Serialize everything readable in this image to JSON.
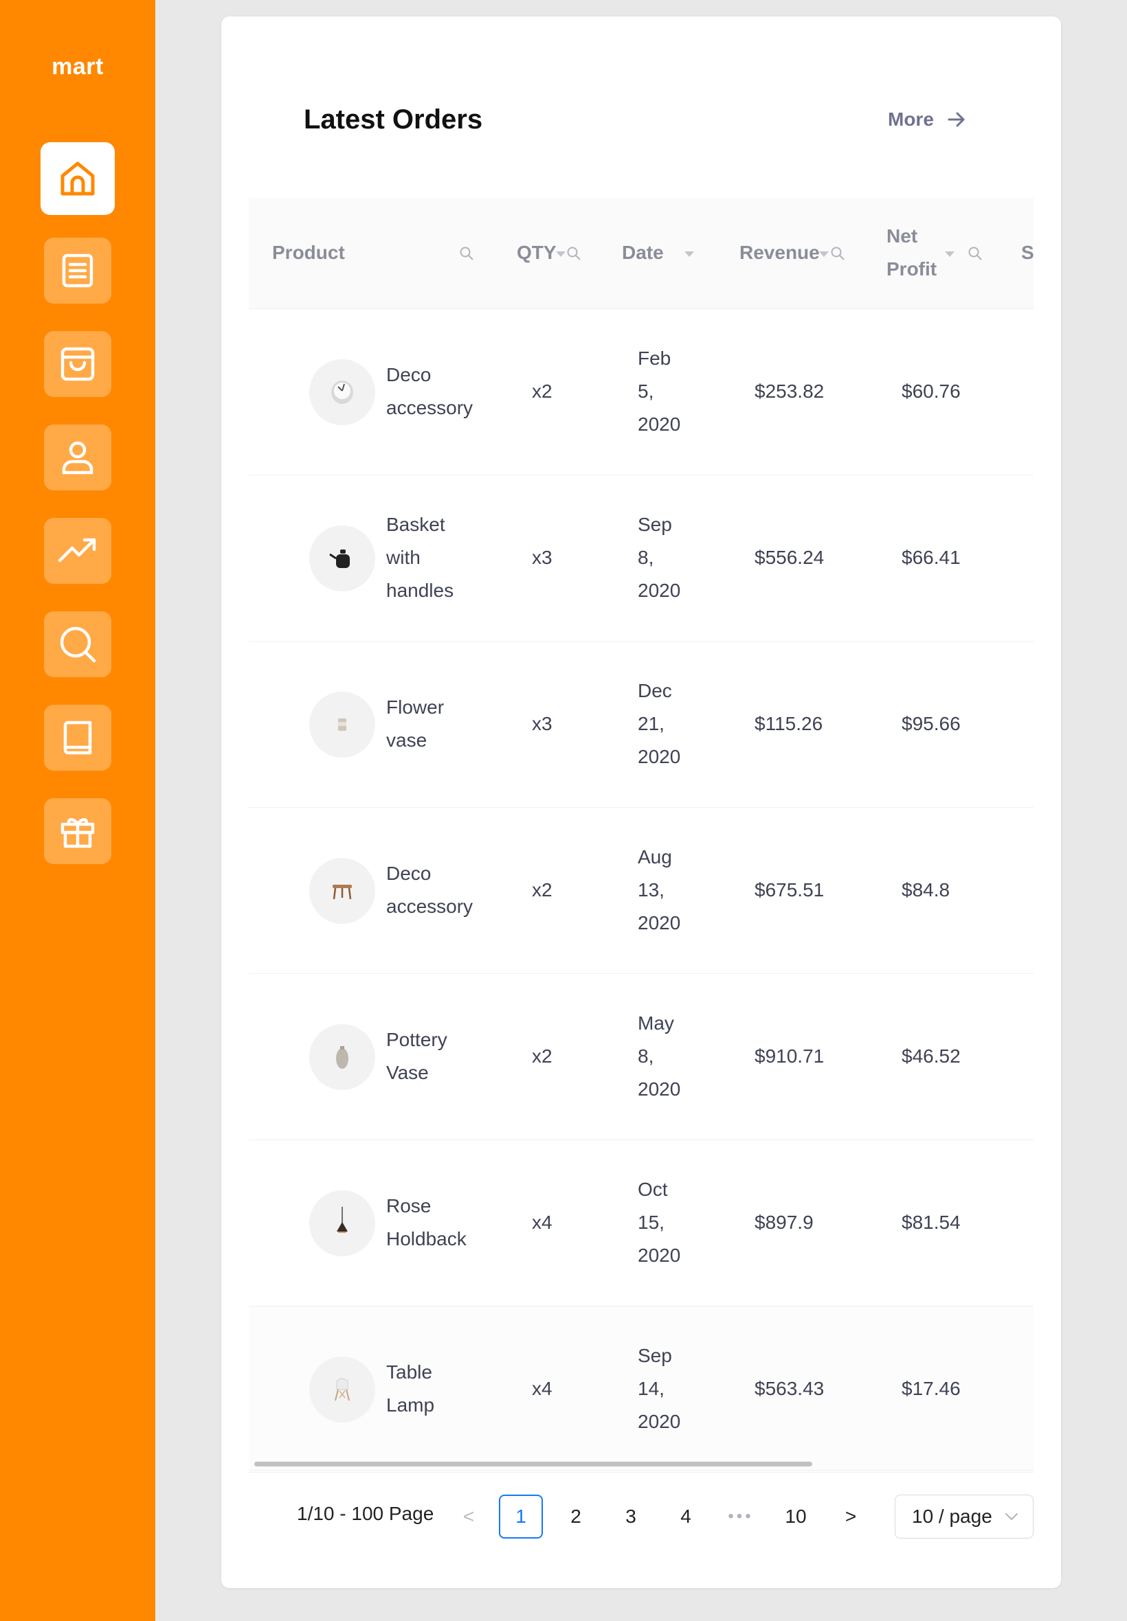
{
  "app": {
    "brand": "mart"
  },
  "sidebar": {
    "items": [
      {
        "icon": "home-icon",
        "active": true
      },
      {
        "icon": "document-icon",
        "active": false
      },
      {
        "icon": "shopping-bag-icon",
        "active": false
      },
      {
        "icon": "user-icon",
        "active": false
      },
      {
        "icon": "trending-up-icon",
        "active": false
      },
      {
        "icon": "search-icon",
        "active": false
      },
      {
        "icon": "book-icon",
        "active": false
      },
      {
        "icon": "gift-icon",
        "active": false
      }
    ]
  },
  "card": {
    "title": "Latest Orders",
    "more_label": "More"
  },
  "table": {
    "columns": {
      "product": "Product",
      "qty": "QTY",
      "date": "Date",
      "revenue": "Revenue",
      "net_profit_1": "Net",
      "net_profit_2": "Profit",
      "status_partial": "S"
    },
    "rows": [
      {
        "product_lines": [
          "Deco",
          "accessory"
        ],
        "thumb": "clock-icon",
        "qty": "x2",
        "date_lines": [
          "Feb",
          "5,",
          "2020"
        ],
        "revenue": "$253.82",
        "net": "$60.76"
      },
      {
        "product_lines": [
          "Basket",
          "with",
          "handles"
        ],
        "thumb": "kettle-icon",
        "qty": "x3",
        "date_lines": [
          "Sep",
          "8,",
          "2020"
        ],
        "revenue": "$556.24",
        "net": "$66.41"
      },
      {
        "product_lines": [
          "Flower",
          "vase"
        ],
        "thumb": "cup-icon",
        "qty": "x3",
        "date_lines": [
          "Dec",
          "21,",
          "2020"
        ],
        "revenue": "$115.26",
        "net": "$95.66"
      },
      {
        "product_lines": [
          "Deco",
          "accessory"
        ],
        "thumb": "stool-icon",
        "qty": "x2",
        "date_lines": [
          "Aug",
          "13,",
          "2020"
        ],
        "revenue": "$675.51",
        "net": "$84.8"
      },
      {
        "product_lines": [
          "Pottery",
          "Vase"
        ],
        "thumb": "vase-icon",
        "qty": "x2",
        "date_lines": [
          "May",
          "8,",
          "2020"
        ],
        "revenue": "$910.71",
        "net": "$46.52"
      },
      {
        "product_lines": [
          "Rose",
          "Holdback"
        ],
        "thumb": "pendant-lamp-icon",
        "qty": "x4",
        "date_lines": [
          "Oct",
          "15,",
          "2020"
        ],
        "revenue": "$897.9",
        "net": "$81.54"
      },
      {
        "product_lines": [
          "Table",
          "Lamp"
        ],
        "thumb": "chair-icon",
        "qty": "x4",
        "date_lines": [
          "Sep",
          "14,",
          "2020"
        ],
        "revenue": "$563.43",
        "net": "$17.46"
      }
    ]
  },
  "pagination": {
    "info": "1/10 - 100 Page",
    "prev": "<",
    "pages": [
      "1",
      "2",
      "3",
      "4"
    ],
    "dots": "•••",
    "last": "10",
    "next": ">",
    "current": "1",
    "page_size": "10 / page"
  },
  "colors": {
    "sidebar": "#ff8800",
    "accent": "#1677ff",
    "background": "#e8e8e8"
  }
}
